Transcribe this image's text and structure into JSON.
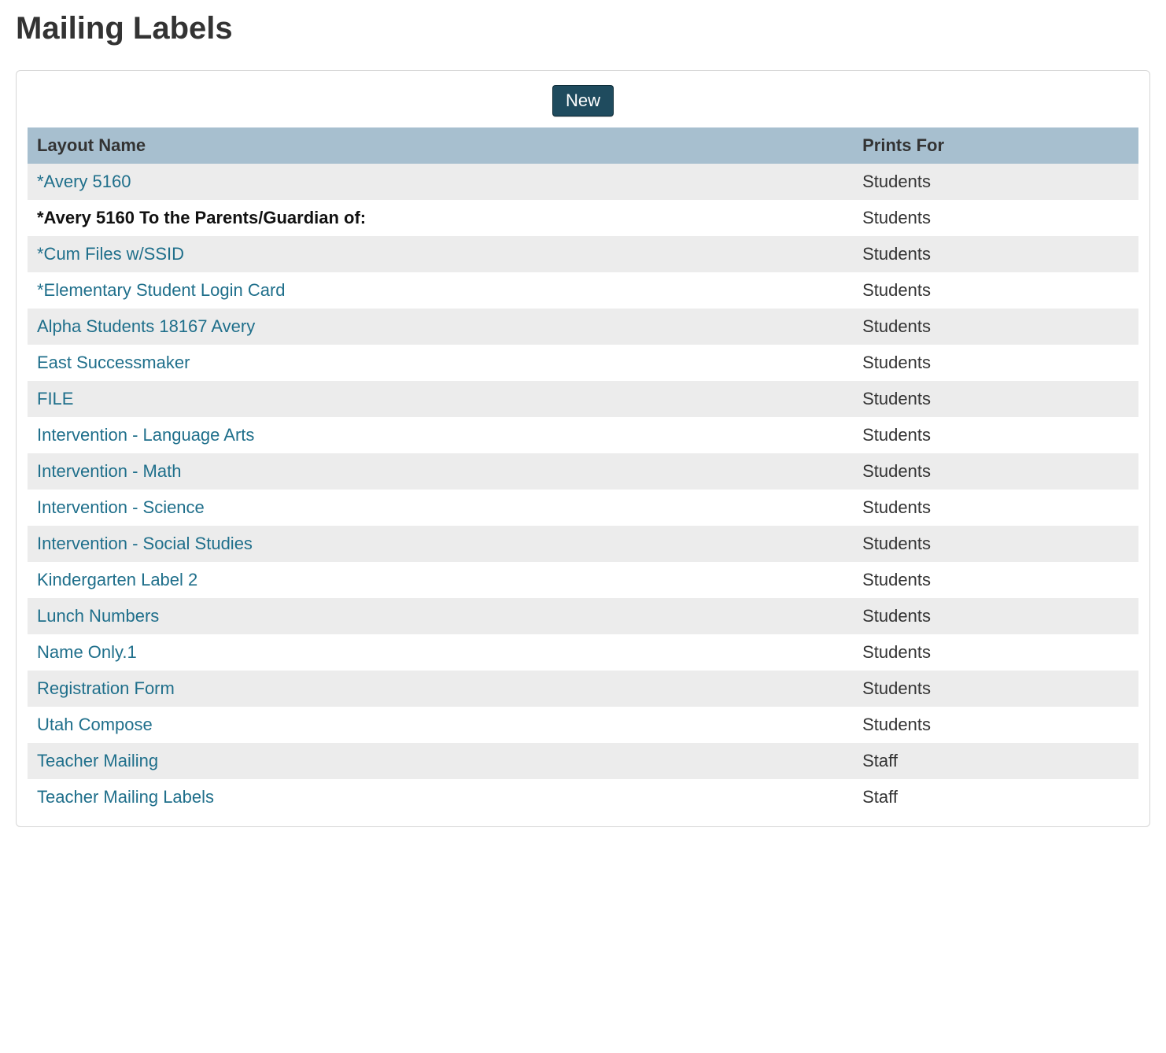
{
  "page": {
    "title": "Mailing Labels"
  },
  "toolbar": {
    "new_label": "New"
  },
  "table": {
    "headers": {
      "layout_name": "Layout Name",
      "prints_for": "Prints For"
    },
    "rows": [
      {
        "layout_name": "*Avery 5160",
        "prints_for": "Students",
        "selected": false
      },
      {
        "layout_name": "*Avery 5160 To the Parents/Guardian of:",
        "prints_for": "Students",
        "selected": true
      },
      {
        "layout_name": "*Cum Files w/SSID",
        "prints_for": "Students",
        "selected": false
      },
      {
        "layout_name": "*Elementary Student Login Card",
        "prints_for": "Students",
        "selected": false
      },
      {
        "layout_name": "Alpha Students 18167 Avery",
        "prints_for": "Students",
        "selected": false
      },
      {
        "layout_name": "East Successmaker",
        "prints_for": "Students",
        "selected": false
      },
      {
        "layout_name": "FILE",
        "prints_for": "Students",
        "selected": false
      },
      {
        "layout_name": "Intervention - Language Arts",
        "prints_for": "Students",
        "selected": false
      },
      {
        "layout_name": "Intervention - Math",
        "prints_for": "Students",
        "selected": false
      },
      {
        "layout_name": "Intervention - Science",
        "prints_for": "Students",
        "selected": false
      },
      {
        "layout_name": "Intervention - Social Studies",
        "prints_for": "Students",
        "selected": false
      },
      {
        "layout_name": "Kindergarten Label 2",
        "prints_for": "Students",
        "selected": false
      },
      {
        "layout_name": "Lunch Numbers",
        "prints_for": "Students",
        "selected": false
      },
      {
        "layout_name": "Name Only.1",
        "prints_for": "Students",
        "selected": false
      },
      {
        "layout_name": "Registration Form",
        "prints_for": "Students",
        "selected": false
      },
      {
        "layout_name": "Utah Compose",
        "prints_for": "Students",
        "selected": false
      },
      {
        "layout_name": "Teacher Mailing",
        "prints_for": "Staff",
        "selected": false
      },
      {
        "layout_name": "Teacher Mailing Labels",
        "prints_for": "Staff",
        "selected": false
      }
    ]
  }
}
